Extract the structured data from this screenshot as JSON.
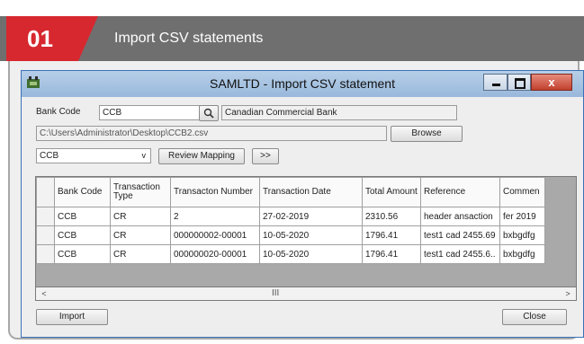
{
  "banner": {
    "step": "01",
    "title": "Import CSV statements"
  },
  "window": {
    "title": "SAMLTD - Import CSV statement",
    "controls": {
      "minimize": "_",
      "maximize": "□",
      "close": "x"
    }
  },
  "form": {
    "bank_code_label": "Bank Code",
    "bank_code_value": "CCB",
    "bank_name": "Canadian Commercial Bank",
    "file_path": "C:\\Users\\Administrator\\Desktop\\CCB2.csv",
    "browse_label": "Browse",
    "mapping_value": "CCB",
    "review_mapping_label": "Review Mapping",
    "next_label": ">>"
  },
  "grid": {
    "columns": [
      "Bank Code",
      "Transaction Type",
      "Transacton Number",
      "Transaction Date",
      "Total Amount",
      "Reference",
      "Commen"
    ],
    "rows": [
      [
        "CCB",
        "CR",
        "2",
        "27-02-2019",
        "2310.56",
        "header ansaction",
        "fer 2019"
      ],
      [
        "CCB",
        "CR",
        "000000002-00001",
        "10-05-2020",
        "1796.41",
        "test1 cad 2455.69",
        "bxbgdfg"
      ],
      [
        "CCB",
        "CR",
        "000000020-00001",
        "10-05-2020",
        "1796.41",
        "test1 cad 2455.6..",
        "bxbgdfg"
      ]
    ],
    "scroll_left": "<",
    "scroll_right": ">",
    "scroll_grip": "III"
  },
  "footer": {
    "import_label": "Import",
    "close_label": "Close"
  },
  "colors": {
    "accent": "#d7282f",
    "banner": "#6f6f6f",
    "titlebar": "#b7cfe8",
    "close_button": "#c2402d"
  },
  "icons": {
    "search": "magnifier-icon",
    "dropdown": "chevron-down-icon",
    "app": "app-icon"
  }
}
